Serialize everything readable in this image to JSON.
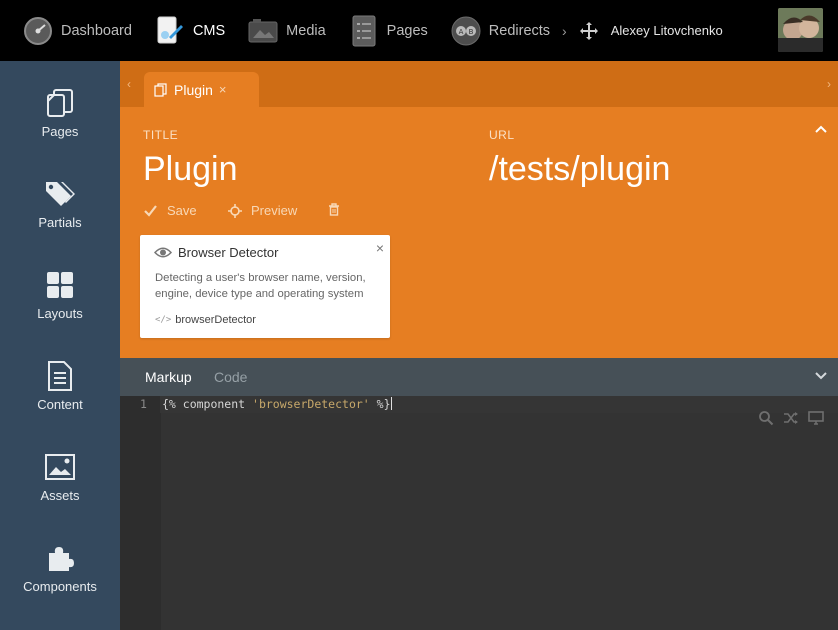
{
  "topbar": {
    "nav": [
      {
        "label": "Dashboard",
        "icon": "dashboard-gauge-icon"
      },
      {
        "label": "CMS",
        "icon": "cms-icon"
      },
      {
        "label": "Media",
        "icon": "media-icon"
      },
      {
        "label": "Pages",
        "icon": "pages-checklist-icon"
      },
      {
        "label": "Redirects",
        "icon": "redirects-ab-icon"
      }
    ],
    "user_name": "Alexey Litovchenko"
  },
  "sidebar": {
    "items": [
      {
        "label": "Pages",
        "icon": "pages-icon"
      },
      {
        "label": "Partials",
        "icon": "tags-icon"
      },
      {
        "label": "Layouts",
        "icon": "layouts-grid-icon"
      },
      {
        "label": "Content",
        "icon": "content-document-icon"
      },
      {
        "label": "Assets",
        "icon": "assets-image-icon"
      },
      {
        "label": "Components",
        "icon": "components-puzzle-icon"
      }
    ]
  },
  "tab": {
    "label": "Plugin",
    "close": "×"
  },
  "form": {
    "title_label": "TITLE",
    "title_value": "Plugin",
    "url_label": "URL",
    "url_value": "/tests/plugin"
  },
  "toolbar": {
    "save_label": "Save",
    "preview_label": "Preview"
  },
  "component": {
    "name": "Browser Detector",
    "description": "Detecting a user's browser name, version, engine, device type and operating system",
    "alias": "browserDetector",
    "close": "×"
  },
  "editor": {
    "tabs": [
      "Markup",
      "Code"
    ],
    "line_number": "1",
    "code_prefix": "{% component ",
    "code_string": "'browserDetector'",
    "code_suffix": " %}"
  },
  "colors": {
    "accent": "#e67e22",
    "sidebar": "#34495e",
    "topbar": "#000000"
  }
}
